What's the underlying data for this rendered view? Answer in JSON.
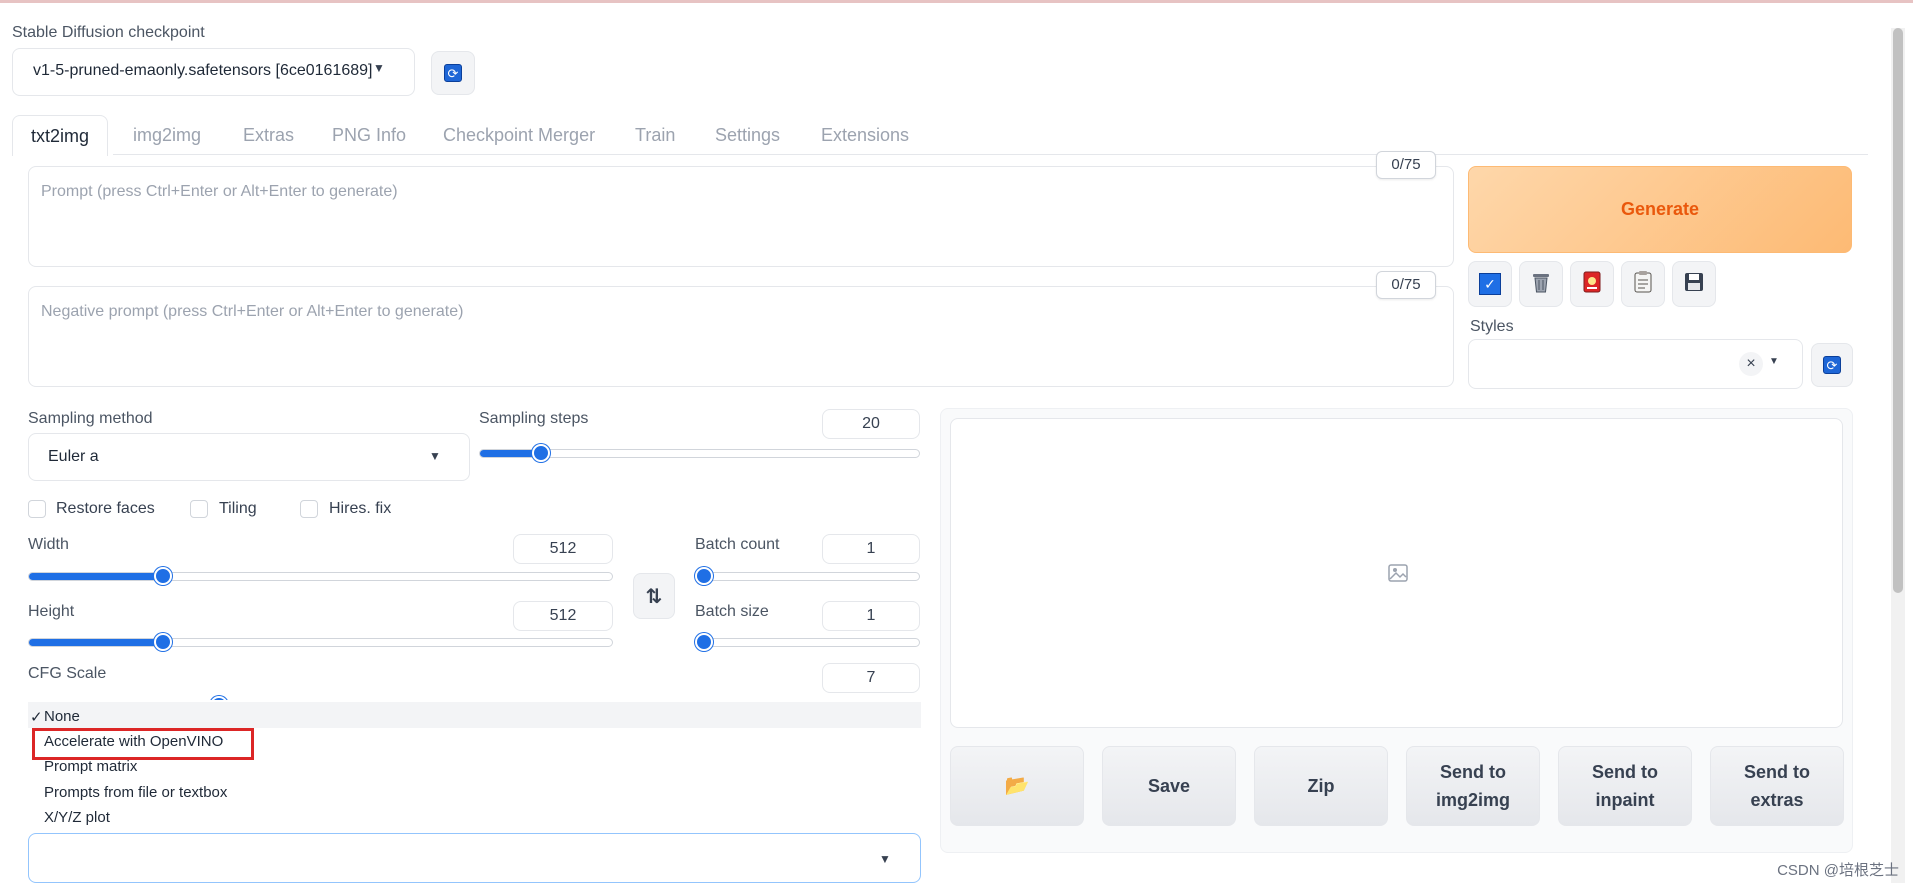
{
  "checkpoint": {
    "label": "Stable Diffusion checkpoint",
    "value": "v1-5-pruned-emaonly.safetensors [6ce0161689]"
  },
  "tabs": [
    "txt2img",
    "img2img",
    "Extras",
    "PNG Info",
    "Checkpoint Merger",
    "Train",
    "Settings",
    "Extensions"
  ],
  "active_tab": "txt2img",
  "prompt": {
    "placeholder": "Prompt (press Ctrl+Enter or Alt+Enter to generate)",
    "counter": "0/75"
  },
  "negative_prompt": {
    "placeholder": "Negative prompt (press Ctrl+Enter or Alt+Enter to generate)",
    "counter": "0/75"
  },
  "generate_label": "Generate",
  "tool_icons": [
    "checkbox-icon",
    "trash-icon",
    "red-card-icon",
    "clipboard-icon",
    "save-disk-icon"
  ],
  "styles": {
    "label": "Styles",
    "clear": "×"
  },
  "sampling_method": {
    "label": "Sampling method",
    "value": "Euler a"
  },
  "sampling_steps": {
    "label": "Sampling steps",
    "value": "20",
    "fraction": 0.14
  },
  "checkboxes": [
    "Restore faces",
    "Tiling",
    "Hires. fix"
  ],
  "width": {
    "label": "Width",
    "value": "512",
    "fraction": 0.23
  },
  "height": {
    "label": "Height",
    "value": "512",
    "fraction": 0.23
  },
  "batch_count": {
    "label": "Batch count",
    "value": "1",
    "fraction": 0.0
  },
  "batch_size": {
    "label": "Batch size",
    "value": "1",
    "fraction": 0.0
  },
  "cfg_scale": {
    "label": "CFG Scale",
    "value": "7"
  },
  "swap_icon": "⇅",
  "script_dropdown": {
    "check": "✓",
    "items": [
      "None",
      "Accelerate with OpenVINO",
      "Prompt matrix",
      "Prompts from file or textbox",
      "X/Y/Z plot"
    ],
    "selected": "None",
    "highlighted": "Accelerate with OpenVINO"
  },
  "actions": {
    "folder": "📂",
    "save": "Save",
    "zip": "Zip",
    "send_img2img_1": "Send to",
    "send_img2img_2": "img2img",
    "send_inpaint_1": "Send to",
    "send_inpaint_2": "inpaint",
    "send_extras_1": "Send to",
    "send_extras_2": "extras"
  },
  "watermark": "CSDN @培根芝士",
  "colors": {
    "accent": "#1f6fe5",
    "generate": "#fdba74",
    "generate_text": "#ea580c",
    "highlight": "#dc2626"
  }
}
